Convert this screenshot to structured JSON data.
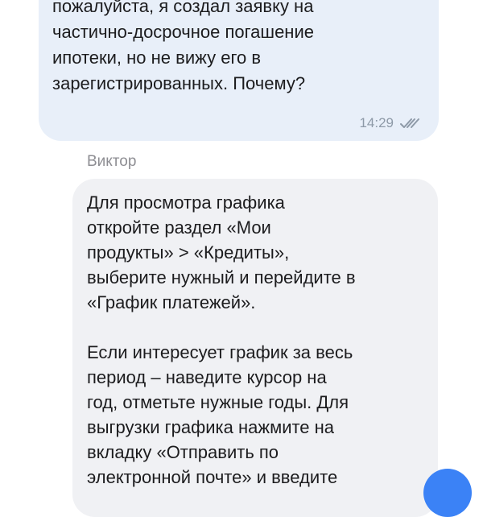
{
  "chat": {
    "outgoing": {
      "text": "Добрый день. Подскажите\nпожалуйста, я создал заявку на\nчастично-досрочное погашение\nипотеки, но не вижу его в\nзарегистрированных. Почему?",
      "time": "14:29",
      "status_icon": "double-check-icon"
    },
    "incoming": {
      "sender": "Виктор",
      "text": "Для просмотра графика\nоткройте раздел «Мои\nпродукты» > «Кредиты»,\nвыберите нужный и перейдите в\n«График платежей».\n\nЕсли интересует график за весь\nпериод – наведите курсор на\nгод, отметьте нужные годы. Для\nвыгрузки графика нажмите на\nвкладку «Отправить по\nэлектронной почте» и введите"
    }
  },
  "colors": {
    "outgoing_bubble": "#e8eff9",
    "incoming_bubble": "#f0f1f4",
    "accent": "#3b82f6",
    "meta": "#8e9aa8"
  }
}
